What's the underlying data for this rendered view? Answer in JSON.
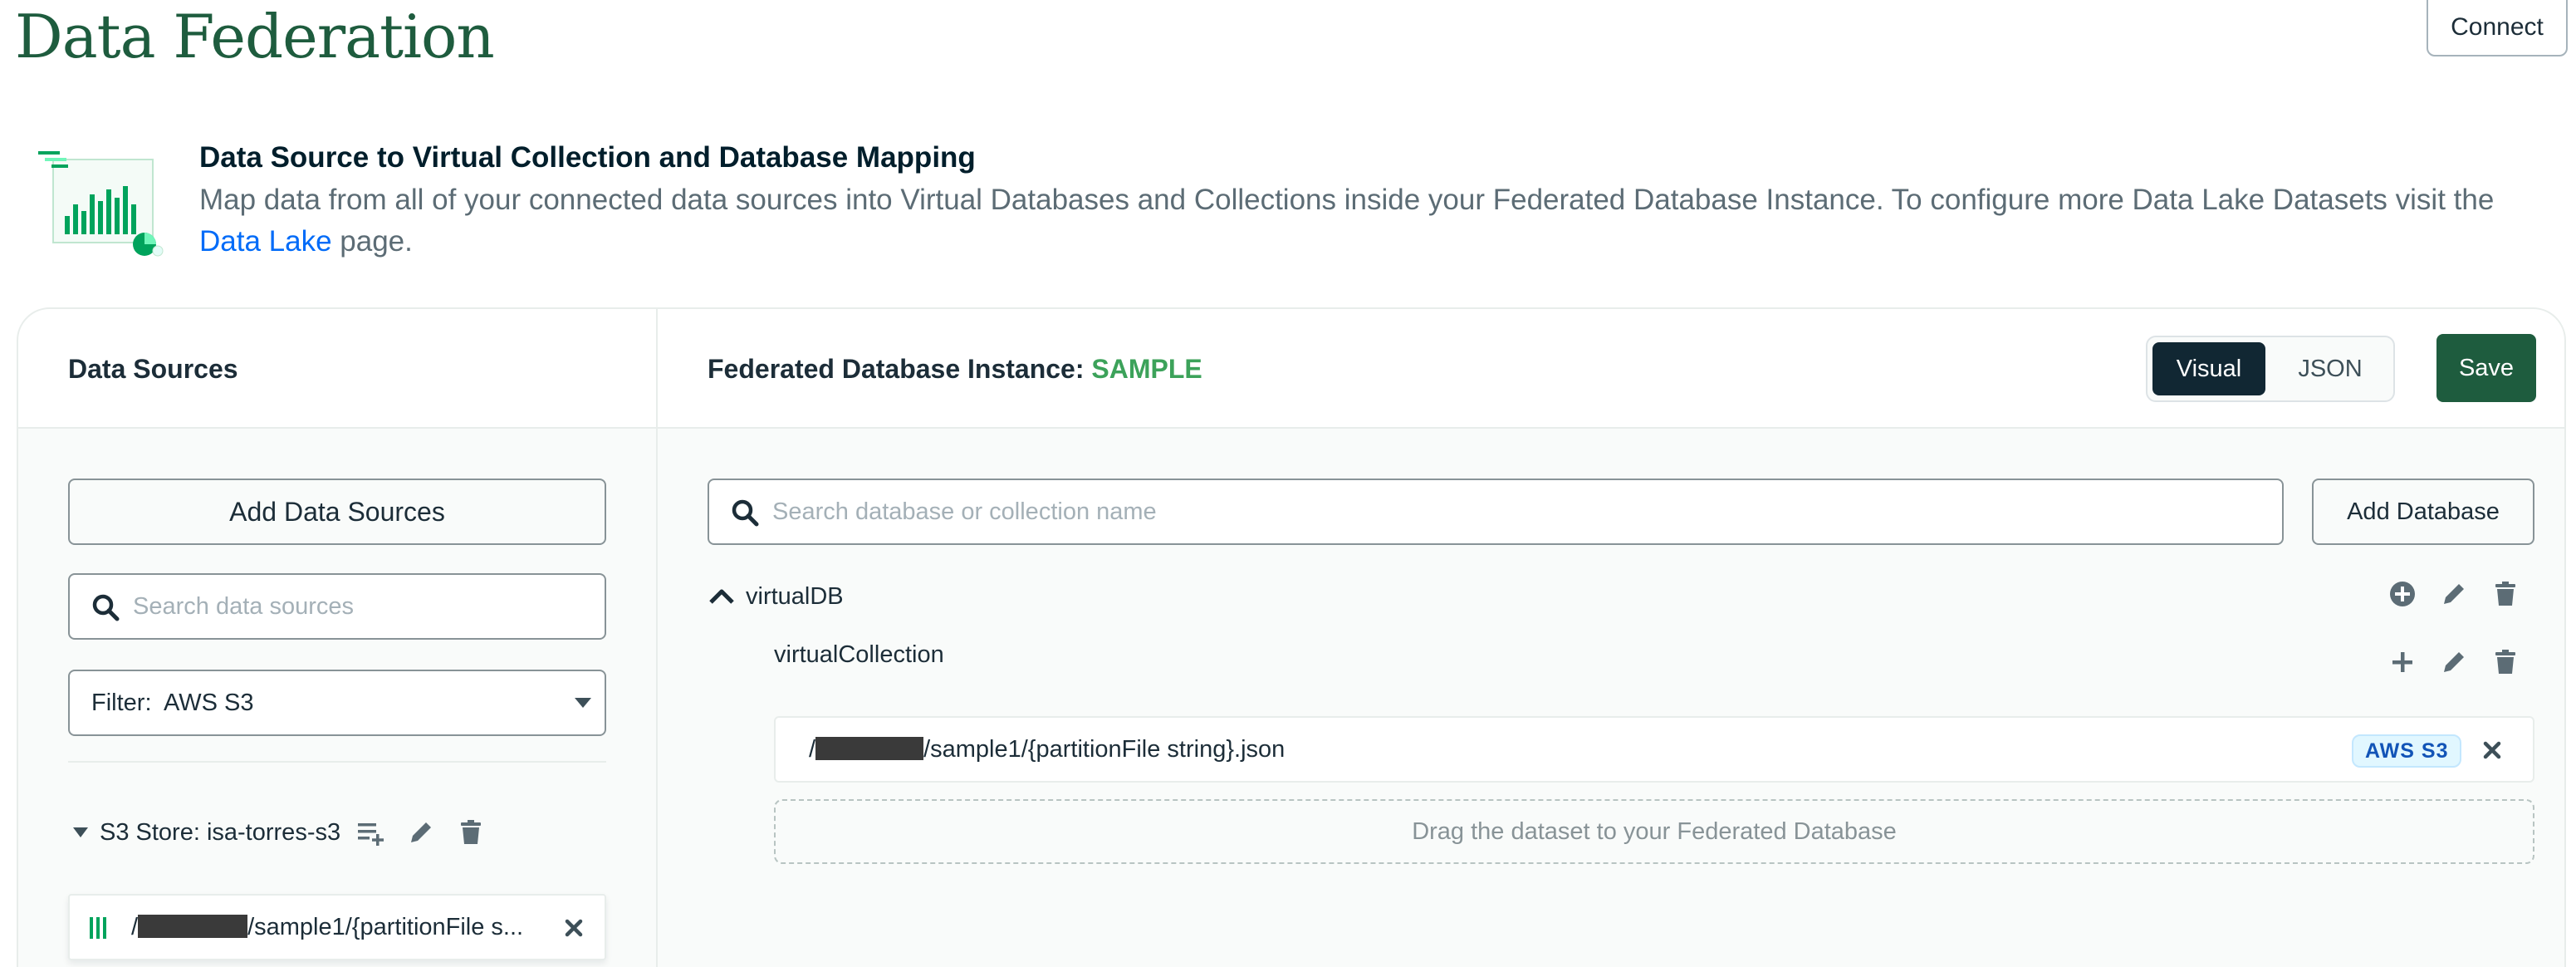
{
  "header": {
    "title": "Data Federation",
    "connect_label": "Connect"
  },
  "banner": {
    "illustration_icon": "chart-illustration-icon",
    "heading": "Data Source to Virtual Collection and Database Mapping",
    "description_prefix": "Map data from all of your connected data sources into Virtual Databases and Collections inside your Federated Database Instance. To configure more Data Lake Datasets visit the ",
    "link_text": "Data Lake",
    "description_suffix": " page."
  },
  "left_panel": {
    "title": "Data Sources",
    "add_button_label": "Add Data Sources",
    "search_placeholder": "Search data sources",
    "filter_label": "Filter:",
    "filter_value": "AWS S3",
    "store": {
      "name": "S3 Store: isa-torres-s3"
    },
    "dataset": {
      "path_prefix": "/",
      "path_suffix": "/sample1/{partitionFile s..."
    }
  },
  "right_panel": {
    "title_prefix": "Federated Database Instance:",
    "instance_name": "SAMPLE",
    "view_toggle": {
      "options": [
        "Visual",
        "JSON"
      ],
      "selected": "Visual"
    },
    "save_label": "Save",
    "search_placeholder": "Search database or collection name",
    "add_database_label": "Add Database",
    "database": {
      "name": "virtualDB",
      "collection": {
        "name": "virtualCollection",
        "data_source": {
          "path_prefix": "/",
          "path_suffix": "/sample1/{partitionFile string}.json",
          "badge": "AWS S3"
        }
      }
    },
    "drop_hint": "Drag the dataset to your Federated Database"
  },
  "colors": {
    "brand_green": "#1e5c3e",
    "instance_green": "#3ca25a",
    "link_blue": "#016bf8",
    "badge_blue": "#1254b7"
  }
}
